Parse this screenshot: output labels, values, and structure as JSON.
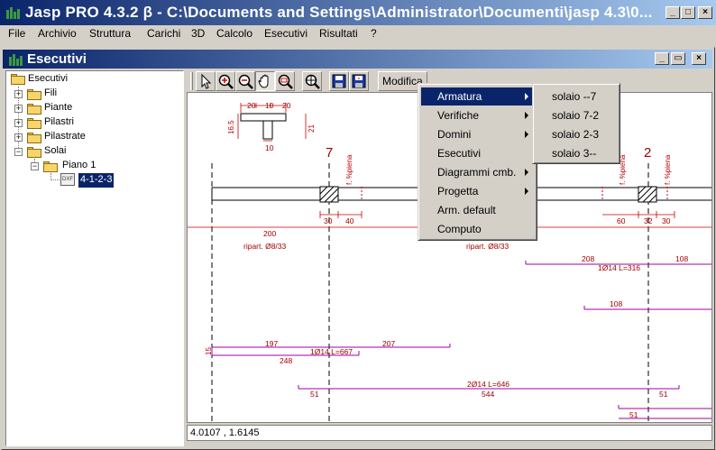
{
  "app": {
    "title": "Jasp PRO 4.3.2 β - C:\\Documents and Settings\\Administrator\\Documenti\\jasp 4.3\\0...",
    "window_buttons": [
      "_",
      "□",
      "×"
    ]
  },
  "menubar": [
    "File",
    "Archivio",
    "Struttura",
    "Carichi",
    "3D",
    "Calcolo",
    "Esecutivi",
    "Risultati",
    "?"
  ],
  "child": {
    "title": "Esecutivi",
    "window_buttons": [
      "_",
      "🗗",
      "×"
    ]
  },
  "tree": {
    "root": "Esecutivi",
    "items": [
      "Fili",
      "Piante",
      "Pilastri",
      "Pilastrate",
      "Solai"
    ],
    "sub": "Piano 1",
    "leaf": "4-1-2-3"
  },
  "toolbar": {
    "modifica_label": "Modifica",
    "icons": [
      "pointer-icon",
      "zoom-in-icon",
      "zoom-out-icon",
      "pan-hand-icon",
      "zoom-window-icon",
      "zoom-extents-icon",
      "save-icon",
      "save-as-icon"
    ]
  },
  "context_menu": {
    "items": [
      "Armatura",
      "Verifiche",
      "Domini",
      "Esecutivi",
      "Diagrammi cmb.",
      "Progetta",
      "Arm. default",
      "Computo"
    ],
    "selected": "Armatura",
    "has_submenu": [
      true,
      true,
      true,
      false,
      true,
      true,
      false,
      false
    ]
  },
  "submenu": {
    "items": [
      "solaio --7",
      "solaio 7-2",
      "solaio 2-3",
      "solaio 3--"
    ]
  },
  "drawing": {
    "section_dims_top": [
      "20",
      "10",
      "20"
    ],
    "section_dim_left": "16.5",
    "section_dim_right": "21",
    "section_dim_bottom": "10",
    "axis_labels": [
      "7",
      "2"
    ],
    "fascia_label": "f. %piena",
    "dims": [
      "30",
      "40",
      "60",
      "32",
      "30",
      "200"
    ],
    "ripart": "ripart. Ø8/33",
    "bars": {
      "b208": "208",
      "b108a": "108",
      "b1phi14_316": "1Ø14 L=316",
      "b108b": "108",
      "b197": "197",
      "b207": "207",
      "b1phi14_667": "1Ø14 L=667",
      "b248": "248",
      "b15": "15",
      "b2phi14_646": "2Ø14 L=646",
      "b51a": "51",
      "b544": "544",
      "b51b": "51",
      "b51c": "51"
    }
  },
  "status": "4.0107 , 1.6145",
  "colors": {
    "titlebar_start": "#0a246a",
    "titlebar_end": "#a6caf0",
    "selection": "#0a246a",
    "rebar": "#a000a0",
    "dims": "#c00000"
  }
}
